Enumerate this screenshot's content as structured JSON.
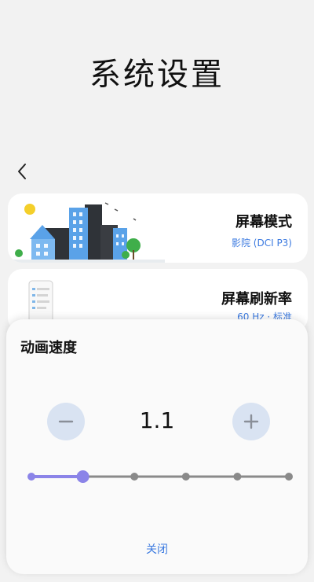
{
  "page": {
    "title": "系统设置"
  },
  "cards": [
    {
      "title": "屏幕模式",
      "subtitle": "影院 (DCI P3)"
    },
    {
      "title": "屏幕刷新率",
      "subtitle": "60 Hz · 标准"
    }
  ],
  "sheet": {
    "title": "动画速度",
    "value": "1.1",
    "close_label": "关闭",
    "slider": {
      "steps": 6,
      "selected_index": 1
    }
  },
  "colors": {
    "accent": "#3d7be0",
    "slider_active": "#8b84e8",
    "slider_inactive": "#8a8a8a",
    "stepper_bg": "#d9e3f2"
  },
  "icons": {
    "back": "chevron-left-icon",
    "minus": "minus-icon",
    "plus": "plus-icon"
  }
}
